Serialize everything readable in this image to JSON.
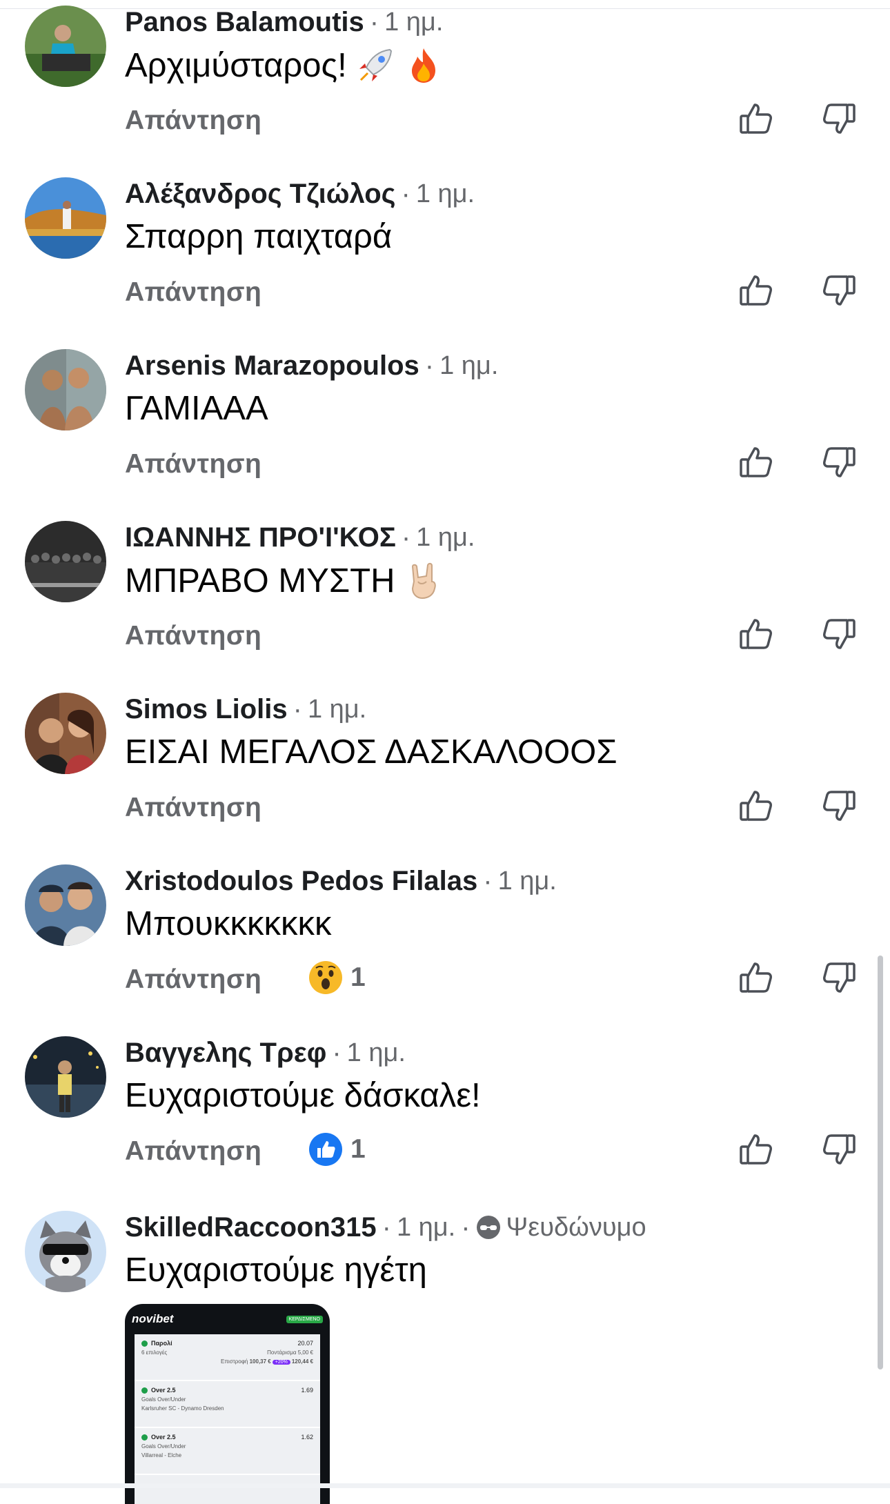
{
  "reply_label": "Απάντηση",
  "separator": "·",
  "comments": [
    {
      "name": "Panos Balamoutis",
      "time": "1 ημ.",
      "text": "Αρχιμύσταρος! ",
      "emojis": [
        "rocket-emoji",
        "fire-emoji"
      ]
    },
    {
      "name": "Αλέξανδρος Τζιώλος",
      "time": "1 ημ.",
      "text": "Σπαρρη παιχταρά"
    },
    {
      "name": "Arsenis Marazopoulos",
      "time": "1 ημ.",
      "text": "ΓΑΜΙΑΑΑ"
    },
    {
      "name": "ΙΩΑΝΝΗΣ ΠΡΟ'Ι'ΚΟΣ",
      "time": "1 ημ.",
      "text": "ΜΠΡΑΒΟ ΜΥΣΤΗ ",
      "emojis": [
        "rock-hand-emoji"
      ]
    },
    {
      "name": "Simos Liolis",
      "time": "1 ημ.",
      "text": "ΕΙΣΑΙ ΜΕΓΑΛΟΣ ΔΑΣΚΑΛΟΟΟΣ"
    },
    {
      "name": "Xristodoulos Pedos Filalas",
      "time": "1 ημ.",
      "text": "Μπουκκκκκκκ",
      "reaction": {
        "icon": "wow-reaction-icon",
        "count": "1"
      }
    },
    {
      "name": "Βαγγελης Τρεφ",
      "time": "1 ημ.",
      "text": "Ευχαριστούμε δάσκαλε!",
      "reaction": {
        "icon": "like-reaction-icon",
        "count": "1"
      }
    },
    {
      "name": "SkilledRaccoon315",
      "time": "1 ημ.",
      "pseudonym": "Ψευδώνυμο",
      "text": "Ευχαριστούμε ηγέτη"
    }
  ],
  "attachment": {
    "brand": "novibet",
    "badge": "ΚΕΡΔΙΣΜΕΝΟ",
    "header_row": {
      "title": "Παρολί",
      "odds": "20.07",
      "selections": "6 επιλογές",
      "stake_label": "Ποντάρισμα",
      "stake": "5,00 €",
      "return_label": "Επιστροφή",
      "return_old": "100,37 €",
      "boost": "+20%",
      "return_new": "120,44 €"
    },
    "bets": [
      {
        "market": "Over 2.5",
        "odds": "1.69",
        "type": "Goals Over/Under",
        "match": "Karlsruher SC - Dynamo Dresden"
      },
      {
        "market": "Over 2.5",
        "odds": "1.62",
        "type": "Goals Over/Under",
        "match": "Villarreal - Elche"
      }
    ]
  },
  "colors": {
    "name": "#1c1e21",
    "meta": "#65676b",
    "like_blue": "#1877f2",
    "wow_yellow": "#f7b928"
  }
}
